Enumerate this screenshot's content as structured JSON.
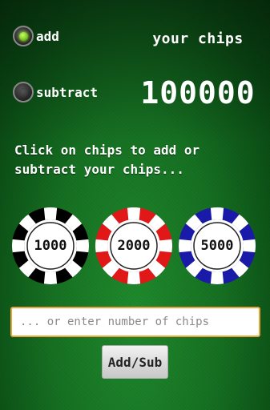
{
  "mode": {
    "add_label": "add",
    "subtract_label": "subtract",
    "selected": "add"
  },
  "chips_panel": {
    "title": "your chips",
    "value": "100000"
  },
  "instructions": "Click on chips to add or subtract your chips...",
  "chips": [
    {
      "value": "1000",
      "color": "#000000"
    },
    {
      "value": "2000",
      "color": "#e01818"
    },
    {
      "value": "5000",
      "color": "#1a1aa8"
    }
  ],
  "amount_input": {
    "value": "",
    "placeholder": "... or enter number of chips"
  },
  "submit_button": {
    "label": "Add/Sub"
  },
  "colors": {
    "felt": "#167022",
    "input_border": "#e8a43a",
    "radio_active": "#7cc31b"
  }
}
